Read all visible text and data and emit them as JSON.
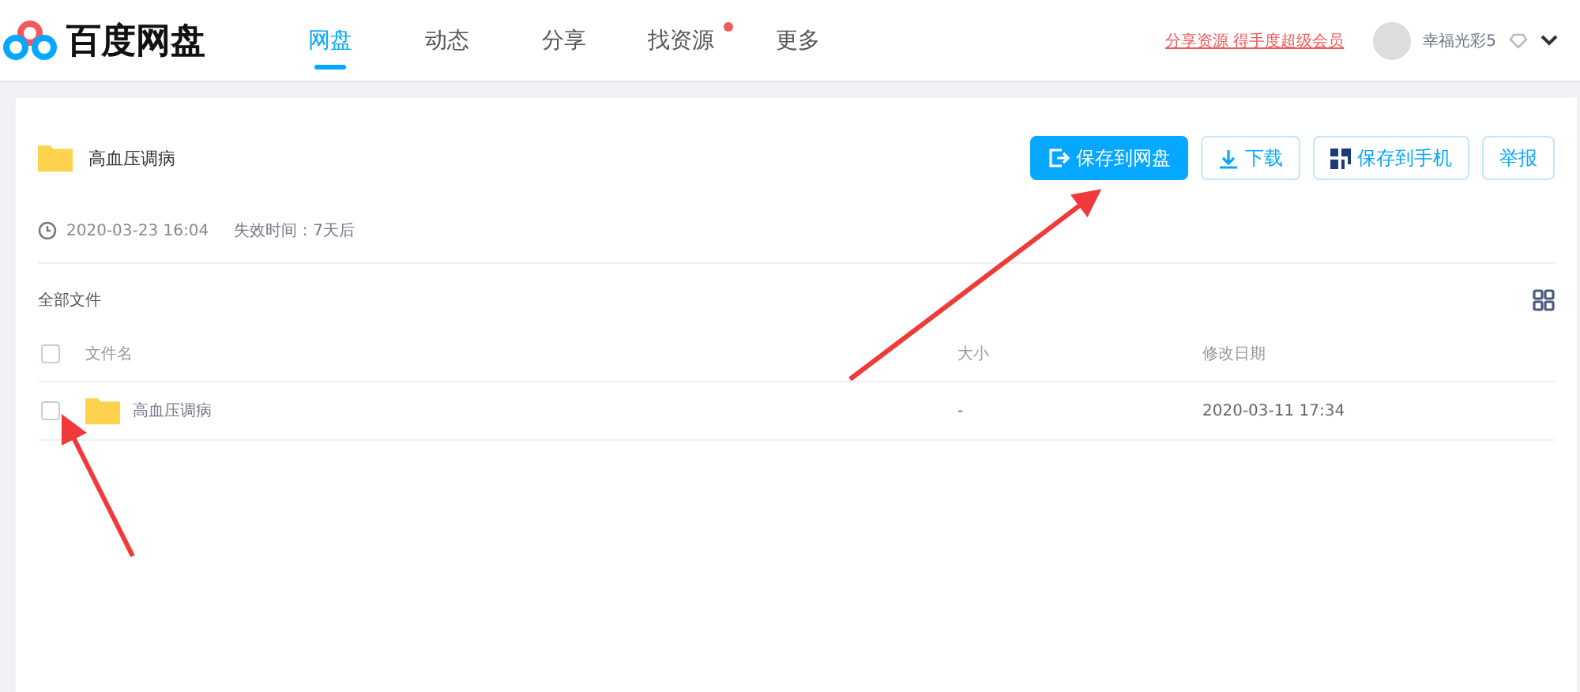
{
  "header": {
    "logo": "百度网盘",
    "nav": [
      {
        "label": "网盘",
        "selected": true,
        "badge": false
      },
      {
        "label": "动态",
        "selected": false,
        "badge": false
      },
      {
        "label": "分享",
        "selected": false,
        "badge": false
      },
      {
        "label": "找资源",
        "selected": false,
        "badge": true
      },
      {
        "label": "更多",
        "selected": false,
        "badge": false
      }
    ],
    "promo_link": "分享资源 得手度超级会员",
    "username": "幸福光彩5"
  },
  "share": {
    "title": "高血压调病",
    "created": "2020-03-23 16:04",
    "expiry": "失效时间：7天后",
    "buttons": [
      {
        "kind": "save",
        "label": "保存到网盘",
        "primary": true
      },
      {
        "kind": "download",
        "label": "下载",
        "primary": false
      },
      {
        "kind": "phone",
        "label": "保存到手机",
        "primary": false
      },
      {
        "kind": "report",
        "label": "举报",
        "primary": false
      }
    ]
  },
  "breadcrumb": "全部文件",
  "table": {
    "columns": [
      "文件名",
      "大小",
      "修改日期"
    ],
    "all_checked": false,
    "rows": [
      {
        "name": "高血压调病",
        "size": "-",
        "modified": "2020-03-11 17:34",
        "checked": false
      }
    ]
  }
}
